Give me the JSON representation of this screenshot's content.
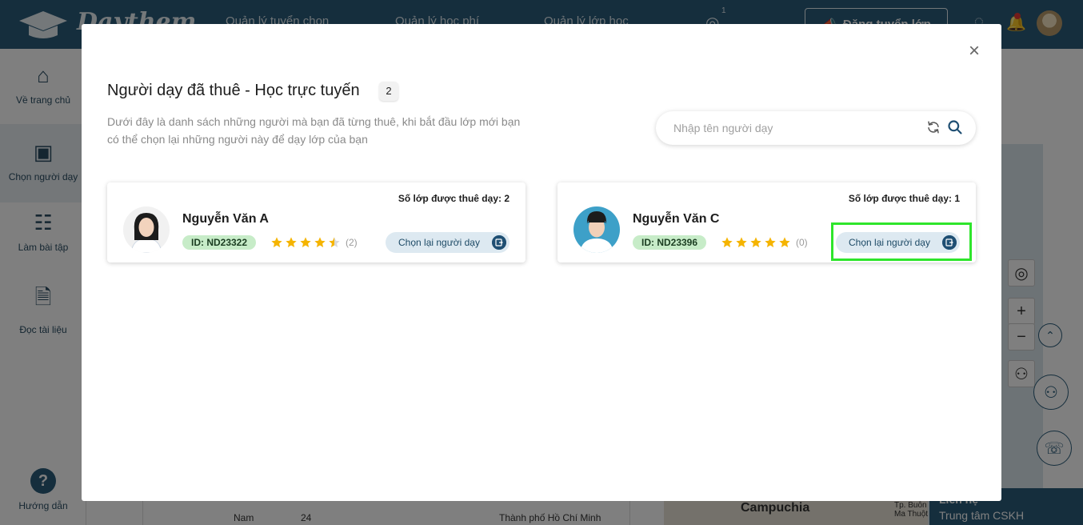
{
  "app": {
    "logo_text": "Daythem"
  },
  "topnav": {
    "items": [
      "Quản lý tuyển chọn",
      "Quản lý học phí",
      "Quản lý lớp học"
    ],
    "chat_badge": "1",
    "post_button": "Đăng tuyển lớp"
  },
  "sidebar": {
    "items": [
      "Về trang chủ",
      "Chọn người dạy",
      "Làm bài tập",
      "Đọc tài liệu",
      "Hướng dẫn"
    ]
  },
  "background": {
    "gender": "Nam",
    "age": "24",
    "location": "Thành phố Hồ Chí Minh",
    "map_label": "Campuchia",
    "map_city": "Tp. Buôn Ma Thuột",
    "cskh_top": "Liên hệ",
    "cskh": "Trung tâm CSKH"
  },
  "modal": {
    "title": "Người dạy đã thuê - Học trực tuyến",
    "count": "2",
    "description": "Dưới đây là danh sách những người mà bạn đã từng thuê, khi bắt đầu lớp mới bạn có thể chọn lại những người này để dạy lớp của bạn",
    "search": {
      "placeholder": "Nhập tên người dạy"
    },
    "teachers": [
      {
        "name": "Nguyễn Văn A",
        "id_label": "ID: ND23322",
        "classes_label": "Số lớp được thuê dạy: 2",
        "rating": 4.5,
        "reviews": "(2)",
        "button_label": "Chọn lại người dạy"
      },
      {
        "name": "Nguyễn Văn C",
        "id_label": "ID: ND23396",
        "classes_label": "Số lớp được thuê dạy: 1",
        "rating": 5,
        "reviews": "(0)",
        "button_label": "Chọn lại người dạy"
      }
    ]
  },
  "colors": {
    "brand": "#2a5c7a",
    "id_badge": "#c7ecc8",
    "star": "#f5b400",
    "highlight": "#2ee52b"
  }
}
